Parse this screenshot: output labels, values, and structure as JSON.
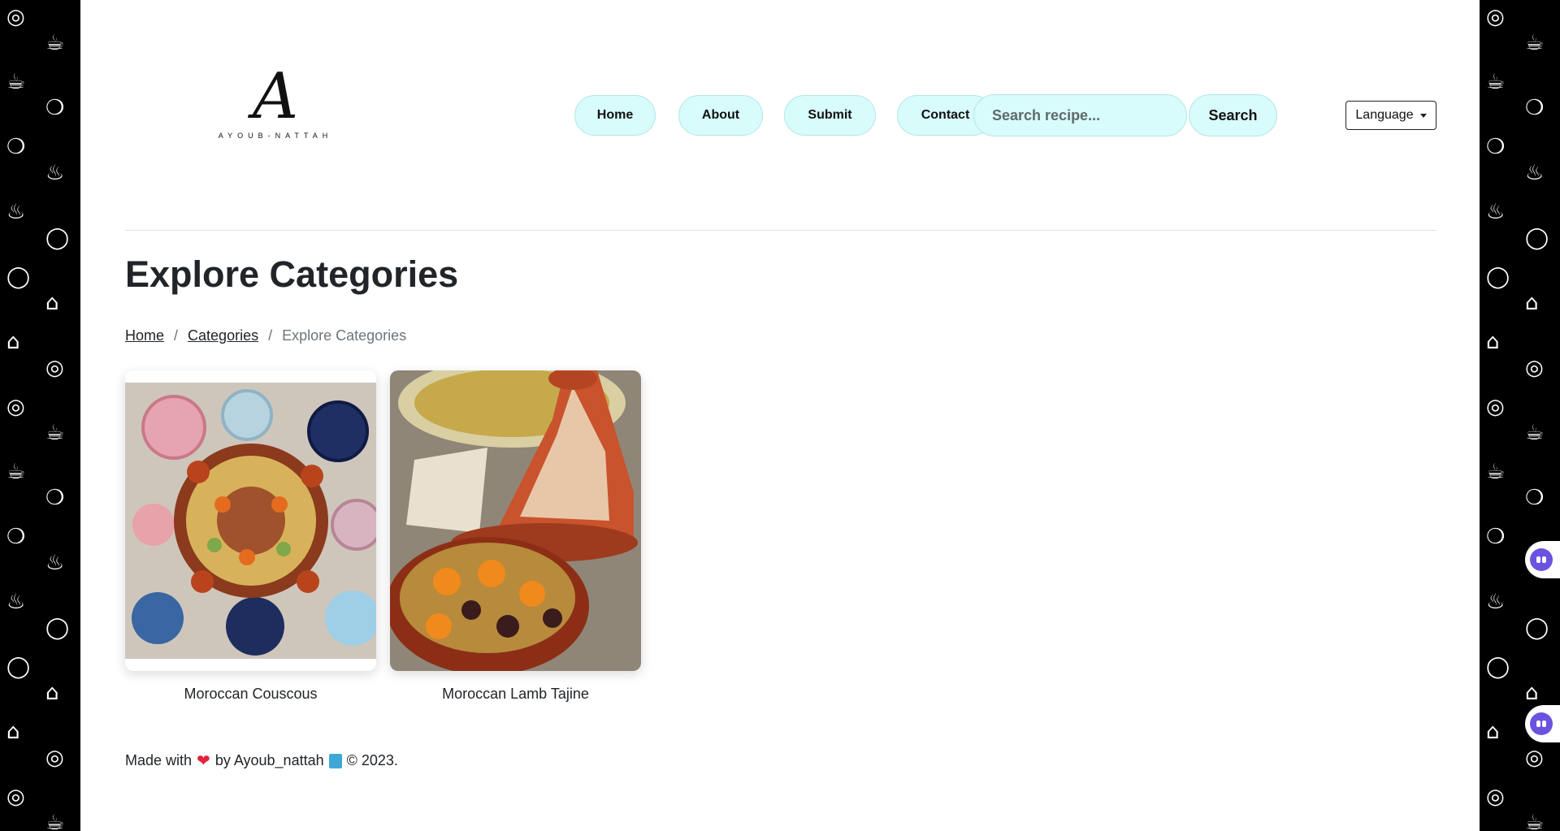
{
  "brand": {
    "logo_mark": "A",
    "logo_wordmark": "AYOUB-NATTAH"
  },
  "nav": {
    "items": [
      {
        "label": "Home"
      },
      {
        "label": "About"
      },
      {
        "label": "Submit"
      },
      {
        "label": "Contact"
      }
    ]
  },
  "search": {
    "placeholder": "Search recipe...",
    "button_label": "Search"
  },
  "language": {
    "label": "Language"
  },
  "page": {
    "title": "Explore Categories"
  },
  "breadcrumb": {
    "items": [
      {
        "label": "Home"
      },
      {
        "label": "Categories"
      }
    ],
    "current": "Explore Categories",
    "separator": "/"
  },
  "recipes": [
    {
      "name": "Moroccan Couscous"
    },
    {
      "name": "Moroccan Lamb Tajine"
    }
  ],
  "footer": {
    "made_with": "Made with",
    "heart": "❤",
    "by": "by Ayoub_nattah",
    "copyright": "© 2023."
  },
  "colors": {
    "pill_bg": "#d8fbfb",
    "pill_border": "#b4e6e6",
    "heart": "#e0243a"
  }
}
